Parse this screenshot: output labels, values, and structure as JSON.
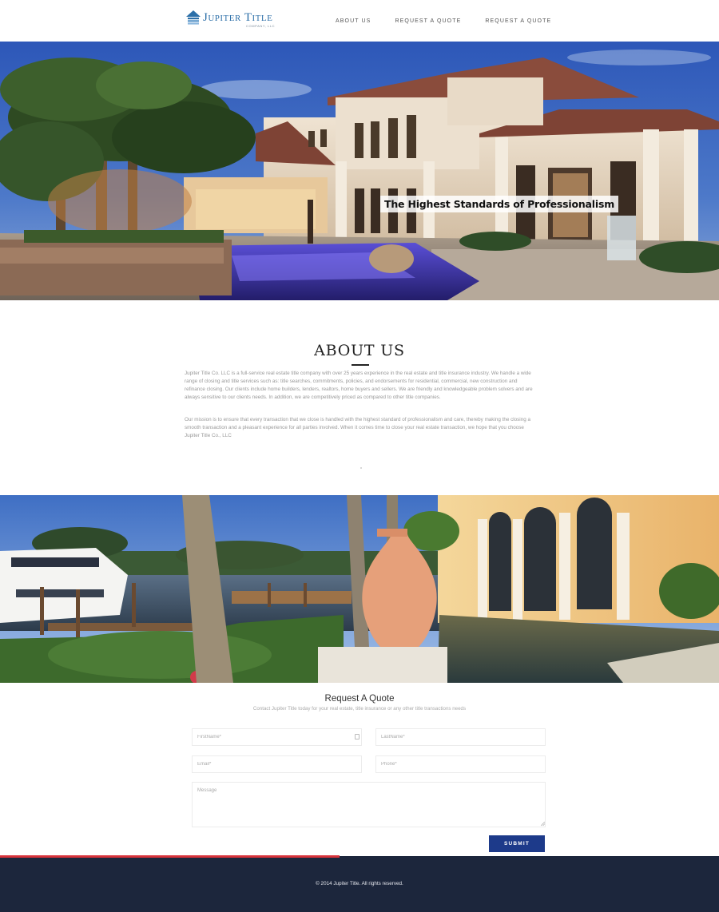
{
  "header": {
    "logo_text": "Jupiter Title",
    "logo_sub": "COMPANY, LLC",
    "nav": [
      "ABOUT US",
      "REQUEST A QUOTE",
      "REQUEST A QUOTE"
    ]
  },
  "hero": {
    "caption": "The Highest Standards of Professionalism",
    "image": "luxury-mansion-pool-dusk"
  },
  "about": {
    "title": "ABOUT US",
    "paragraph1": "Jupiter Title Co. LLC is a full-service real estate title company with over 25 years experience in the real estate and title insurance industry. We handle a wide range of closing and title services such as: title searches, commitments, policies, and endorsements for residential, commercial, new construction and refinance closing. Our clients include home builders, lenders, realtors, home buyers and sellers. We are friendly and knowledgeable problem solvers and are always sensitive to our clients needs. In addition, we are competitively priced as compared to other title companies.",
    "paragraph2": "Our mission is to ensure that every transaction that we close is handled with the highest standard of professionalism and care, thereby making the closing a smooth transaction and a pleasant experience for all parties involved. When it comes time to close your real estate transaction, we hope that you choose Jupiter Title Co., LLC"
  },
  "photo2": {
    "image": "marina-yachts-palms-villa-pool"
  },
  "quote": {
    "title": "Request A Quote",
    "subtitle": "Contact Jupiter Title today for your real estate, title insurance or any other title transactions needs",
    "first_name_placeholder": "FirstName*",
    "last_name_placeholder": "LastName*",
    "email_placeholder": "Email*",
    "phone_placeholder": "Phone*",
    "message_placeholder": "Message",
    "submit_label": "SUBMIT"
  },
  "footer": {
    "copyright": "© 2014 Jupiter Title. All rights reserved."
  },
  "colors": {
    "brand_blue": "#2c6fa8",
    "submit_blue": "#1d3a8a",
    "footer_bg": "#1c263c",
    "footer_accent": "#d8333b"
  }
}
